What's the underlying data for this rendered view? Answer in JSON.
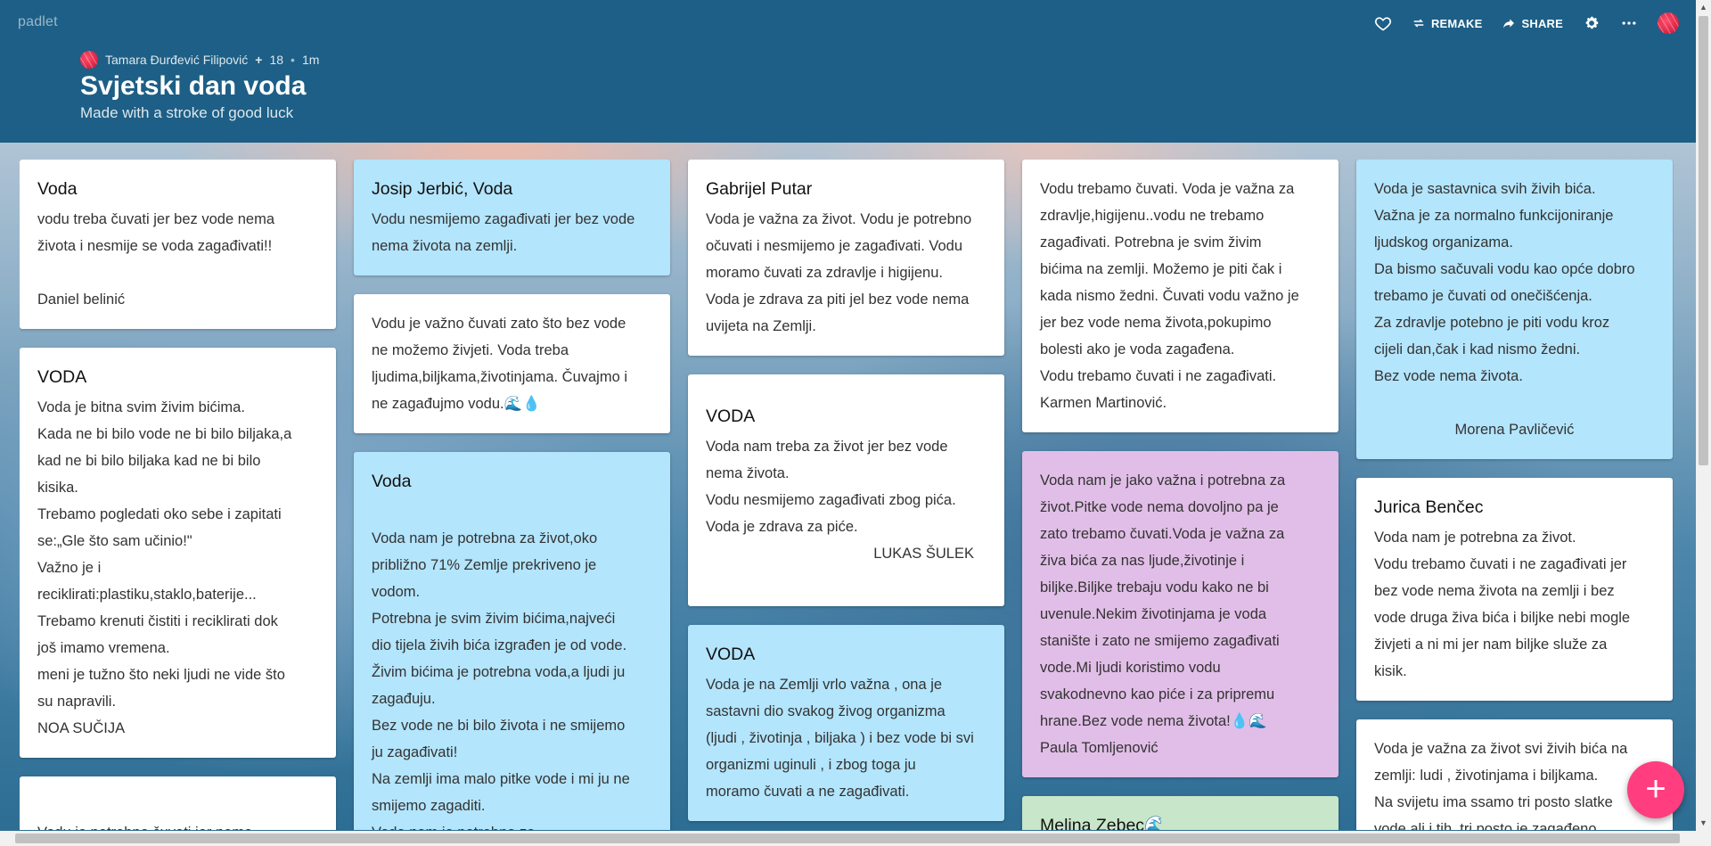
{
  "app": {
    "logo": "padlet"
  },
  "topbar": {
    "remake_label": "REMAKE",
    "share_label": "SHARE"
  },
  "meta": {
    "author": "Tamara Đurđević Filipović",
    "plus_sign": "+",
    "count": "18",
    "separator": "•",
    "time": "1m"
  },
  "padlet": {
    "title": "Svjetski dan voda",
    "subtitle": "Made with a stroke of good luck"
  },
  "columns": [
    [
      {
        "color": "white",
        "title": "Voda",
        "lines": [
          "vodu treba čuvati jer bez vode nema",
          "života i nesmije se voda zagađivati!!",
          " ",
          "Daniel belinić"
        ]
      },
      {
        "color": "white",
        "title": "VODA",
        "lines": [
          "Voda je bitna svim živim bićima.",
          "Kada ne bi bilo vode ne bi bilo biljaka,a",
          "kad ne bi bilo biljaka kad ne bi bilo",
          "kisika.",
          "Trebamo pogledati oko sebe i zapitati",
          "se:„Gle što sam učinio!\"",
          "Važno je i",
          "reciklirati:plastiku,staklo,baterije...",
          "Trebamo krenuti čistiti i reciklirati dok",
          "još imamo vremena.",
          "meni je tužno što neki ljudi ne vide što",
          "su napravili.",
          "NOA SUČIJA"
        ]
      },
      {
        "color": "white",
        "title": "",
        "lines": [
          " ",
          "Vodu je potrebno čuvati jer nema"
        ]
      }
    ],
    [
      {
        "color": "blue",
        "title": "Josip Jerbić, Voda",
        "lines": [
          "Vodu nesmijemo zagađivati jer bez vode",
          "nema života na zemlji."
        ]
      },
      {
        "color": "white",
        "title": "",
        "lines": [
          "Vodu je važno čuvati zato što bez vode",
          "ne možemo živjeti. Voda treba",
          "ljudima,biljkama,životinjama. Čuvajmo i",
          "ne zagađujmo vodu.🌊💧"
        ]
      },
      {
        "color": "blue",
        "title": "Voda",
        "lines": [
          " ",
          "Voda nam je potrebna za život,oko",
          "približno 71% Zemlje prekriveno je",
          "vodom.",
          "Potrebna je svim živim bićima,najveći",
          "dio tijela živih bića izgrađen je od vode.",
          "Živim bićima je potrebna voda,a ljudi ju",
          "zagađuju.",
          "Bez vode ne bi bilo života i ne smijemo",
          "ju zagađivati!",
          "Na zemlji ima malo pitke vode i mi ju ne",
          "smijemo zagaditi.",
          "Voda nam je potrebna za"
        ]
      }
    ],
    [
      {
        "color": "white",
        "title": "Gabrijel Putar",
        "lines": [
          "Voda je važna za život. Vodu je potrebno",
          "očuvati i nesmijemo je zagađivati. Vodu",
          "moramo čuvati za zdravlje i higijenu.",
          "Voda je zdrava za piti jel bez vode nema",
          "uvijeta na Zemlji."
        ]
      },
      {
        "color": "white",
        "title": " ",
        "title2": "VODA",
        "lines": [
          "Voda nam treba za život jer bez vode",
          "nema života.",
          "Vodu nesmijemo zagađivati zbog pića.",
          "Voda je zdrava za piće."
        ],
        "signature": "LUKAS ŠULEK"
      },
      {
        "color": "blue",
        "title": "VODA",
        "lines": [
          "Voda je na Zemlji vrlo važna , ona je",
          "sastavni dio svakog živog organizma",
          "(ljudi , životinja , biljaka ) i bez vode bi svi",
          "organizmi uginuli , i zbog toga ju",
          "moramo čuvati a ne zagađivati."
        ]
      }
    ],
    [
      {
        "color": "white",
        "title": "",
        "lines": [
          "Vodu trebamo čuvati. Voda je važna za",
          "zdravlje,higijenu..vodu ne trebamo",
          "zagađivati. Potrebna je svim živim",
          "bićima na zemlji. Možemo je piti čak i",
          "kada nismo žedni. Čuvati vodu važno je",
          "jer bez vode nema života,pokupimo",
          "bolesti ako je voda zagađena.",
          "Vodu trebamo čuvati i ne zagađivati.",
          "Karmen Martinović."
        ]
      },
      {
        "color": "purple",
        "title": "",
        "lines": [
          "Voda nam je jako važna i potrebna za",
          "život.Pitke vode nema dovoljno pa je",
          "zato trebamo čuvati.Voda je važna za",
          "živa bića za nas ljude,životinje i",
          "biljke.Biljke trebaju vodu kako ne bi",
          "uvenule.Nekim životinjama je voda",
          "stanište i zato ne smijemo zagađivati",
          "vode.Mi ljudi koristimo vodu",
          "svakodnevno kao piće i za pripremu",
          "hrane.Bez vode nema života!💧🌊",
          "Paula Tomljenović"
        ]
      },
      {
        "color": "green",
        "title": "Melina Zebec🌊",
        "lines": []
      }
    ],
    [
      {
        "color": "blue",
        "title": "",
        "lines": [
          "Voda je sastavnica svih živih bića.",
          "Važna je za normalno funkcijoniranje",
          "ljudskog organizama.",
          "Da bismo sačuvali vodu kao opće dobro",
          "trebamo je čuvati od onečišćenja.",
          "Za zdravlje potebno je piti vodu kroz",
          "cijeli dan,čak i kad nismo žedni.",
          "Bez vode nema života.",
          " "
        ],
        "signature_center": "Morena Pavličević"
      },
      {
        "color": "white",
        "title": "Jurica Benčec",
        "lines": [
          "Voda nam je potrebna za život.",
          "Vodu trebamo čuvati i ne zagađivati jer",
          "bez vode nema života na zemlji i bez",
          "vode druga živa bića i biljke nebi mogle",
          "živjeti a ni mi jer nam biljke služe za",
          "kisik."
        ]
      },
      {
        "color": "white",
        "title": "",
        "lines": [
          "Voda je važna za život svi živih bića na",
          "zemlji: ludi , životinjama i biljkama.",
          "Na svijetu ima ssamo tri posto slatke",
          "vode ali i tih  tri posto je zagađeno."
        ]
      }
    ]
  ],
  "fab": {
    "label": "+"
  }
}
